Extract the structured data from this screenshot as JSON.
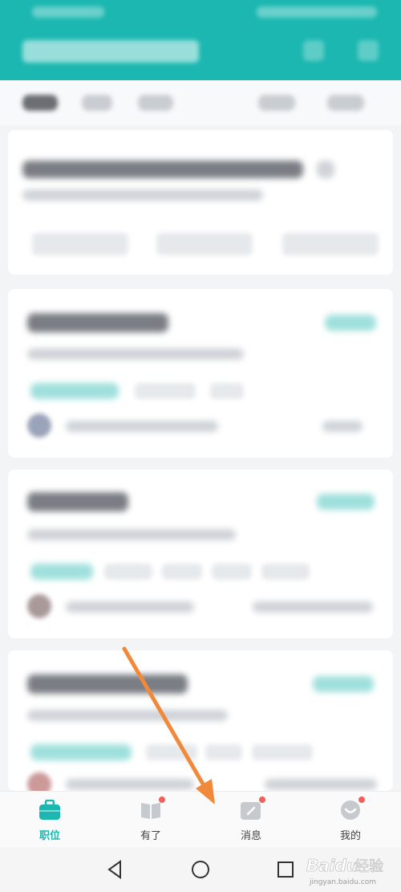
{
  "colors": {
    "brand": "#1bb7b0",
    "annotation_arrow": "#f08a3a",
    "badge": "#f0605d"
  },
  "bottom_nav": {
    "items": [
      {
        "label": "职位",
        "icon": "briefcase-icon",
        "active": true,
        "badge": false
      },
      {
        "label": "有了",
        "icon": "book-icon",
        "active": false,
        "badge": true
      },
      {
        "label": "消息",
        "icon": "message-icon",
        "active": false,
        "badge": true
      },
      {
        "label": "我的",
        "icon": "profile-icon",
        "active": false,
        "badge": true
      }
    ]
  },
  "system_nav": {
    "back": "back-triangle-icon",
    "home": "home-circle-icon",
    "recents": "recents-square-icon"
  },
  "watermark": {
    "brand": "Baidu",
    "text": "经验",
    "url": "jingyan.baidu.com"
  }
}
